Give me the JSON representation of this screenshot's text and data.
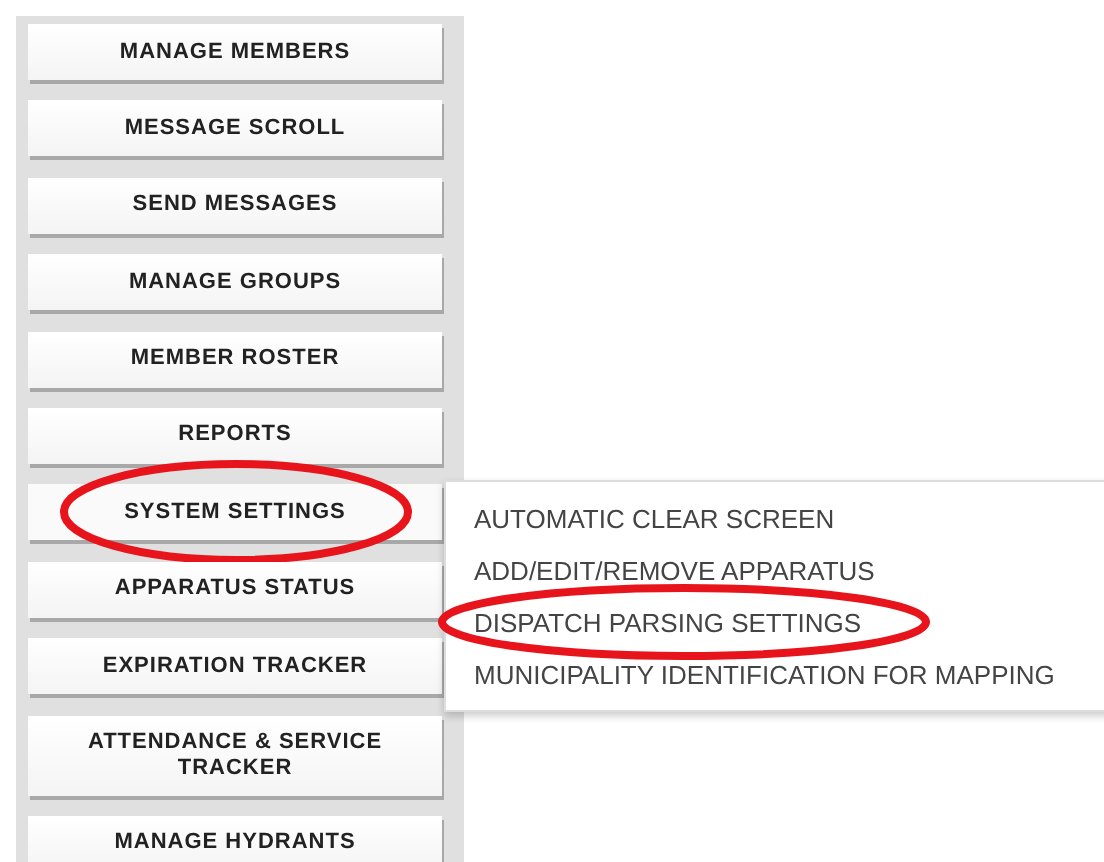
{
  "nav_buttons": [
    {
      "label": "MANAGE MEMBERS",
      "circled": false,
      "expanded": false
    },
    {
      "label": "MESSAGE SCROLL",
      "circled": false,
      "expanded": false
    },
    {
      "label": "SEND MESSAGES",
      "circled": false,
      "expanded": false
    },
    {
      "label": "MANAGE GROUPS",
      "circled": false,
      "expanded": false
    },
    {
      "label": "MEMBER ROSTER",
      "circled": false,
      "expanded": false
    },
    {
      "label": "REPORTS",
      "circled": false,
      "expanded": false
    },
    {
      "label": "SYSTEM SETTINGS",
      "circled": true,
      "expanded": true
    },
    {
      "label": "APPARATUS STATUS",
      "circled": false,
      "expanded": false
    },
    {
      "label": "EXPIRATION TRACKER",
      "circled": false,
      "expanded": false
    },
    {
      "label": "ATTENDANCE & SERVICE TRACKER",
      "circled": false,
      "expanded": false
    },
    {
      "label": "MANAGE HYDRANTS",
      "circled": false,
      "expanded": false
    }
  ],
  "submenu": [
    {
      "label": "AUTOMATIC CLEAR SCREEN",
      "circled": false
    },
    {
      "label": "ADD/EDIT/REMOVE APPARATUS",
      "circled": false
    },
    {
      "label": "DISPATCH PARSING SETTINGS",
      "circled": true
    },
    {
      "label": "MUNICIPALITY IDENTIFICATION FOR MAPPING",
      "circled": false
    }
  ]
}
